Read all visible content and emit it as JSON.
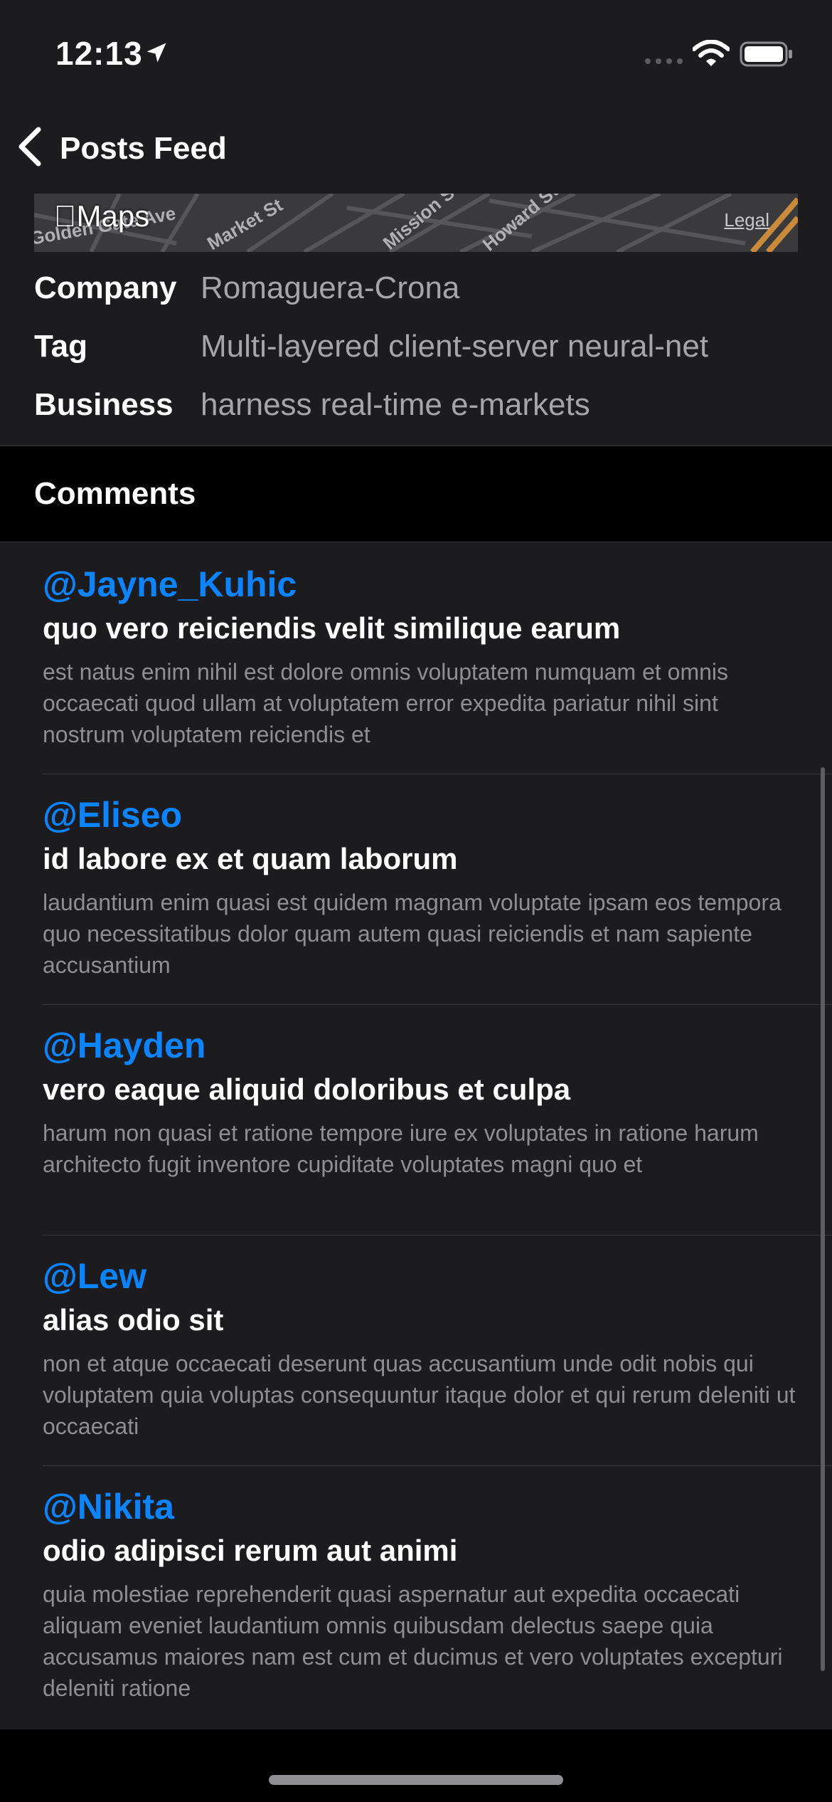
{
  "status_bar": {
    "time": "12:13",
    "icons": [
      "location-arrow-icon",
      "cellular-signal-icon",
      "wifi-icon",
      "battery-icon"
    ]
  },
  "nav": {
    "back_icon": "chevron-left-icon",
    "title": "Posts Feed"
  },
  "map": {
    "logo_label": "Maps",
    "legal_label": "Legal",
    "street_labels": [
      "Golden Gate Ave",
      "Market St",
      "Mission St",
      "Howard St"
    ]
  },
  "info": [
    {
      "key": "Company",
      "value": "Romaguera-Crona"
    },
    {
      "key": "Tag",
      "value": "Multi-layered client-server neural-net"
    },
    {
      "key": "Business",
      "value": "harness real-time e-markets"
    }
  ],
  "comments_header": "Comments",
  "comments": [
    {
      "user": "@Jayne_Kuhic",
      "title": "quo vero reiciendis velit similique earum",
      "body": "est natus enim nihil est dolore omnis voluptatem numquam et omnis occaecati quod ullam at voluptatem error expedita pariatur nihil sint nostrum voluptatem reiciendis et"
    },
    {
      "user": "@Eliseo",
      "title": "id labore ex et quam laborum",
      "body": "laudantium enim quasi est quidem magnam voluptate ipsam eos tempora quo necessitatibus dolor quam autem quasi reiciendis et nam sapiente accusantium"
    },
    {
      "user": "@Hayden",
      "title": "vero eaque aliquid doloribus et culpa",
      "body": "harum non quasi et ratione tempore iure ex voluptates in ratione harum architecto fugit inventore cupiditate voluptates magni quo et"
    },
    {
      "user": "@Lew",
      "title": "alias odio sit",
      "body": "non et atque occaecati deserunt quas accusantium unde odit nobis qui voluptatem quia voluptas consequuntur itaque dolor et qui rerum deleniti ut occaecati"
    },
    {
      "user": "@Nikita",
      "title": "odio adipisci rerum aut animi",
      "body": "quia molestiae reprehenderit quasi aspernatur aut expedita occaecati aliquam eveniet laudantium omnis quibusdam delectus saepe quia accusamus maiores nam est cum et ducimus et vero voluptates excepturi deleniti ratione"
    }
  ],
  "colors": {
    "background": "#1c1c1e",
    "accent": "#0a84ff",
    "secondary_text": "#8e8e93"
  }
}
